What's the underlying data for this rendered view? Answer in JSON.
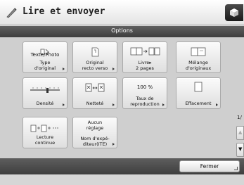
{
  "app": {
    "title": "Lire et envoyer"
  },
  "header": {
    "title": "Options"
  },
  "tiles": [
    {
      "icon_text": "Texte/Photo",
      "label": "Type\nd'original"
    },
    {
      "label": "Original\nrecto verso"
    },
    {
      "label": "Livre▸\n2 pages"
    },
    {
      "label": "Mélange\nd'originaux"
    },
    {
      "label": "Densité"
    },
    {
      "label": "Netteté"
    },
    {
      "icon_text": "100 %",
      "label": "Taux de\nreproduction"
    },
    {
      "label": "Effacement"
    },
    {
      "label": "Lecture\ncontinue"
    },
    {
      "icon_text": "Aucun\nréglage",
      "label": "Nom d'expé-\nditeur(ITE)"
    }
  ],
  "pager": {
    "text": "1/"
  },
  "footer": {
    "close_label": "Fermer"
  },
  "colors": {
    "header_bg": "#4a4a4a",
    "panel_bg": "#cfcfcf"
  }
}
